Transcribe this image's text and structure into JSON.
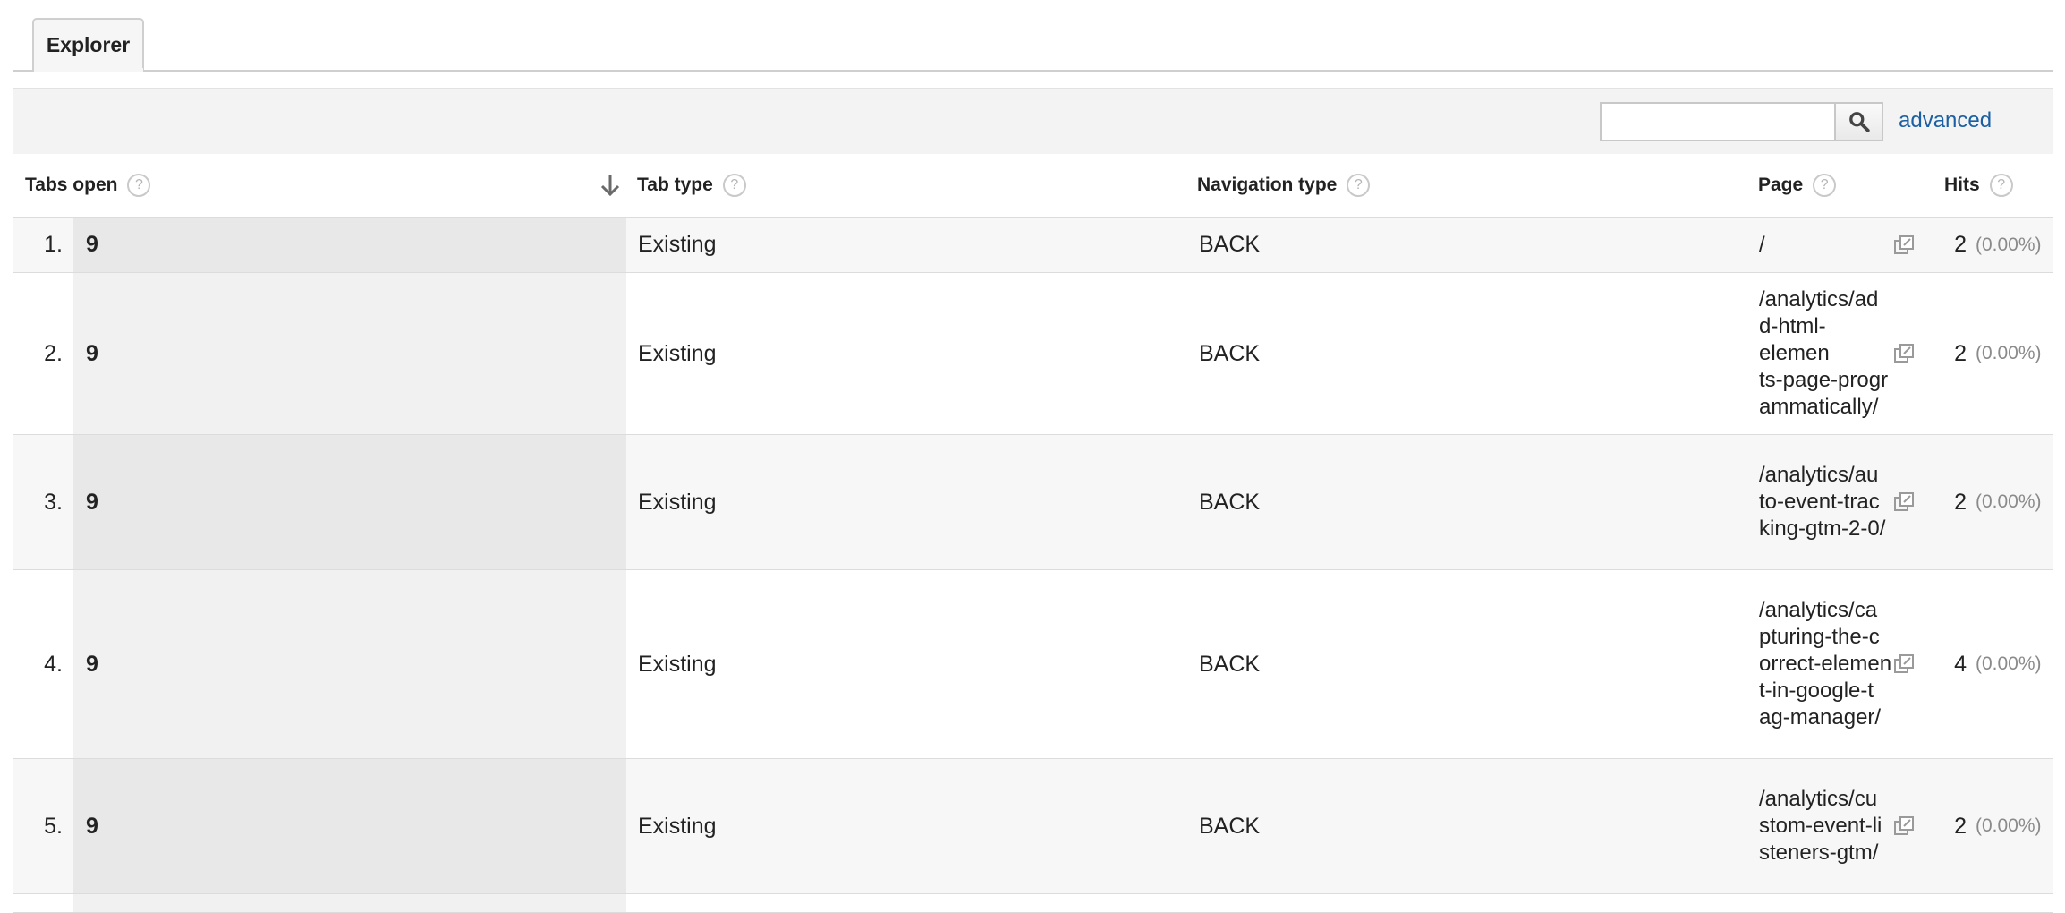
{
  "tabs": [
    {
      "label": "Explorer"
    }
  ],
  "toolbar": {
    "search_value": "",
    "advanced_label": "advanced"
  },
  "columns": {
    "tabs_open": "Tabs open",
    "tab_type": "Tab type",
    "navigation_type": "Navigation type",
    "page": "Page",
    "hits": "Hits"
  },
  "rows": [
    {
      "rank": "1.",
      "tabs_open": "9",
      "tab_type": "Existing",
      "navigation_type": "BACK",
      "page": "/",
      "hits": "2",
      "pct": "(0.00%)"
    },
    {
      "rank": "2.",
      "tabs_open": "9",
      "tab_type": "Existing",
      "navigation_type": "BACK",
      "page": "/analytics/add-html-elements-page-programmatically/",
      "hits": "2",
      "pct": "(0.00%)"
    },
    {
      "rank": "3.",
      "tabs_open": "9",
      "tab_type": "Existing",
      "navigation_type": "BACK",
      "page": "/analytics/auto-event-tracking-gtm-2-0/",
      "hits": "2",
      "pct": "(0.00%)"
    },
    {
      "rank": "4.",
      "tabs_open": "9",
      "tab_type": "Existing",
      "navigation_type": "BACK",
      "page": "/analytics/capturing-the-correct-element-in-google-tag-manager/",
      "hits": "4",
      "pct": "(0.00%)"
    },
    {
      "rank": "5.",
      "tabs_open": "9",
      "tab_type": "Existing",
      "navigation_type": "BACK",
      "page": "/analytics/custom-event-listeners-gtm/",
      "hits": "2",
      "pct": "(0.00%)"
    }
  ]
}
